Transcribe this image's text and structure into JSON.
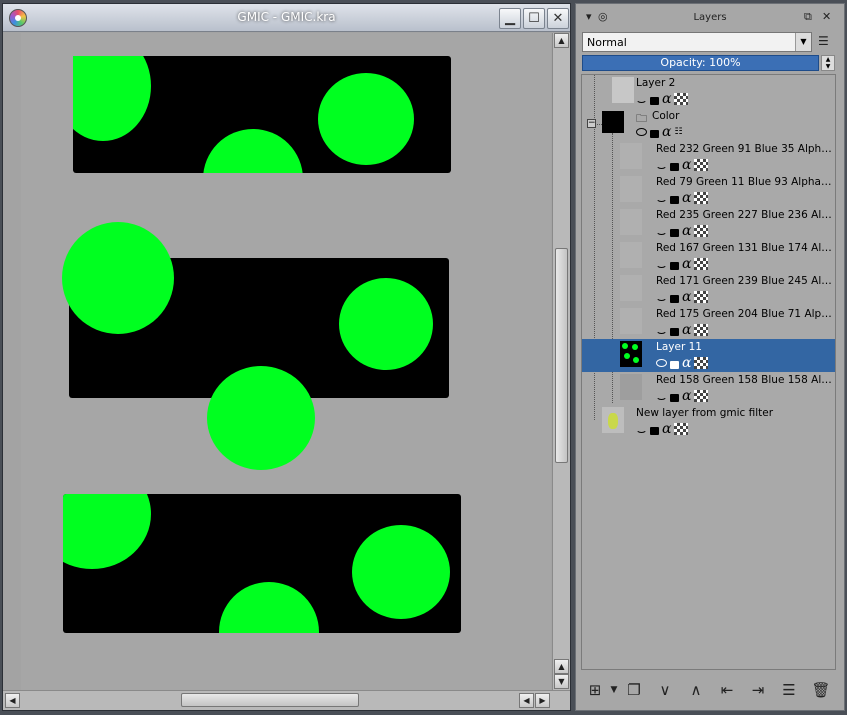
{
  "window": {
    "title": "GMIC - GMIC.kra",
    "minimize_icon": "minimize-icon",
    "maximize_icon": "maximize-icon",
    "close_icon": "close-icon"
  },
  "canvas": {
    "background": "#a6a6a6",
    "shape_color": "#000000",
    "circle_color": "#00ff20"
  },
  "docker": {
    "title": "Layers",
    "blend_mode": "Normal",
    "opacity_label": "Opacity:  100%"
  },
  "layers": [
    {
      "name": "Layer 2",
      "visible": false,
      "alpha_lock": "checker"
    },
    {
      "name": "Color",
      "visible": true,
      "group": true
    },
    {
      "name": "Red 232 Green 91 Blue 35 Alpha ...",
      "visible": false
    },
    {
      "name": "Red 79 Green 11 Blue 93 Alpha 255",
      "visible": false
    },
    {
      "name": "Red 235 Green 227 Blue 236 Alph...",
      "visible": false
    },
    {
      "name": "Red 167 Green 131 Blue 174 Alph...",
      "visible": false
    },
    {
      "name": "Red 171 Green 239 Blue 245 Alph...",
      "visible": false
    },
    {
      "name": "Red 175 Green 204 Blue 71 Alpha...",
      "visible": false
    },
    {
      "name": "Layer 11",
      "visible": true,
      "selected": true
    },
    {
      "name": "Red 158 Green 158 Blue 158 Alph...",
      "visible": false
    },
    {
      "name": "New layer from gmic filter",
      "visible": false
    }
  ],
  "bottom_bar": {
    "icons": [
      "add-layer-icon",
      "duplicate-layer-icon",
      "move-down-icon",
      "move-up-icon",
      "indent-left-icon",
      "indent-right-icon",
      "layer-properties-icon",
      "delete-layer-icon"
    ]
  }
}
